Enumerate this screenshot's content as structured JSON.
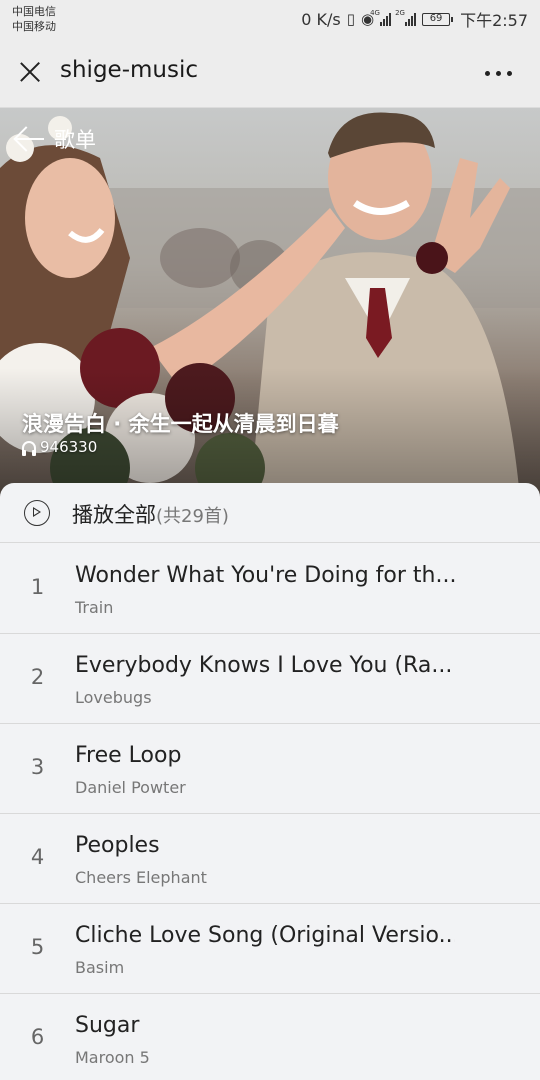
{
  "status_bar": {
    "carrier1": "中国电信",
    "carrier2": "中国移动",
    "speed": "0 K/s",
    "net1": "4G",
    "net2": "2G",
    "battery": "69",
    "time": "下午2:57"
  },
  "titlebar": {
    "title": "shige-music",
    "close_icon": "close-icon",
    "more_icon": "more-icon"
  },
  "hero": {
    "back_label": "歌单",
    "playlist_title": "浪漫告白 · 余生一起从清晨到日暮",
    "play_count": "946330"
  },
  "play_all": {
    "label": "播放全部",
    "count": "(共29首)"
  },
  "songs": [
    {
      "index": "1",
      "name": "Wonder What You're Doing for th...",
      "artist": "Train"
    },
    {
      "index": "2",
      "name": "Everybody Knows I Love You (Ra...",
      "artist": "Lovebugs"
    },
    {
      "index": "3",
      "name": "Free Loop",
      "artist": "Daniel Powter"
    },
    {
      "index": "4",
      "name": "Peoples",
      "artist": "Cheers Elephant"
    },
    {
      "index": "5",
      "name": "Cliche Love Song (Original Versio...",
      "artist": "Basim"
    },
    {
      "index": "6",
      "name": "Sugar",
      "artist": "Maroon 5"
    }
  ]
}
